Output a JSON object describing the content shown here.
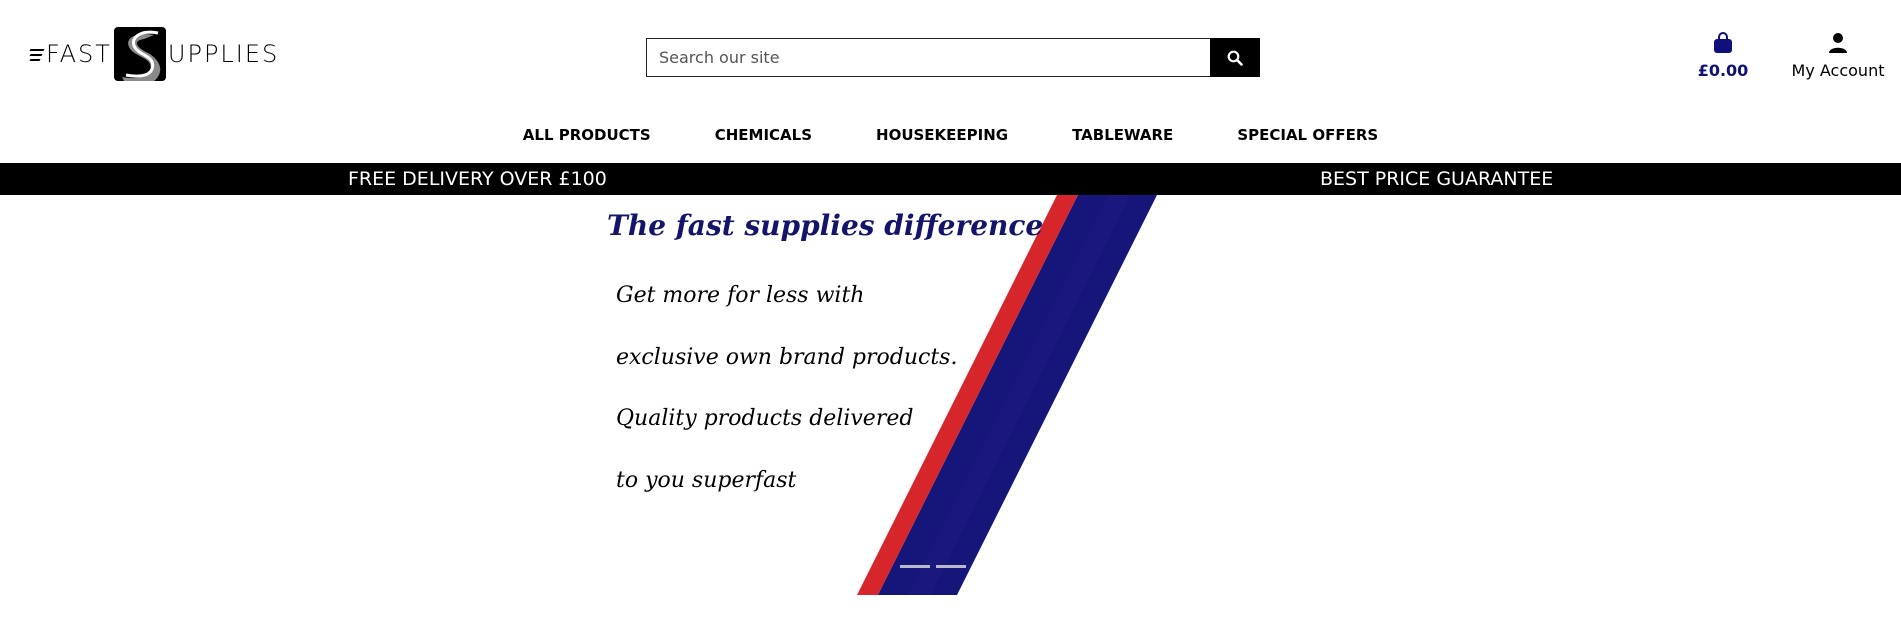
{
  "header": {
    "logo": {
      "word_left": "FAST",
      "word_right": "UPPLIES"
    },
    "search": {
      "placeholder": "Search our site",
      "icon": "search-icon"
    },
    "cart": {
      "amount": "£0.00",
      "icon": "shopping-bag-icon"
    },
    "account": {
      "label": "My Account",
      "icon": "user-icon"
    }
  },
  "nav": {
    "items": [
      {
        "label": "ALL PRODUCTS"
      },
      {
        "label": "CHEMICALS"
      },
      {
        "label": "HOUSEKEEPING"
      },
      {
        "label": "TABLEWARE"
      },
      {
        "label": "SPECIAL OFFERS"
      }
    ]
  },
  "promo": {
    "left": "FREE DELIVERY OVER £100",
    "right": "BEST PRICE GUARANTEE"
  },
  "hero": {
    "title": "The fast supplies difference",
    "lines": [
      "Get more for less with",
      "exclusive own brand products.",
      "Quality products delivered",
      "to you superfast"
    ],
    "slide_count": 2
  },
  "colors": {
    "brand_navy": "#10107a",
    "stripe_red": "#d6262b",
    "stripe_navy": "#15157a",
    "promo_bar": "#000000"
  }
}
